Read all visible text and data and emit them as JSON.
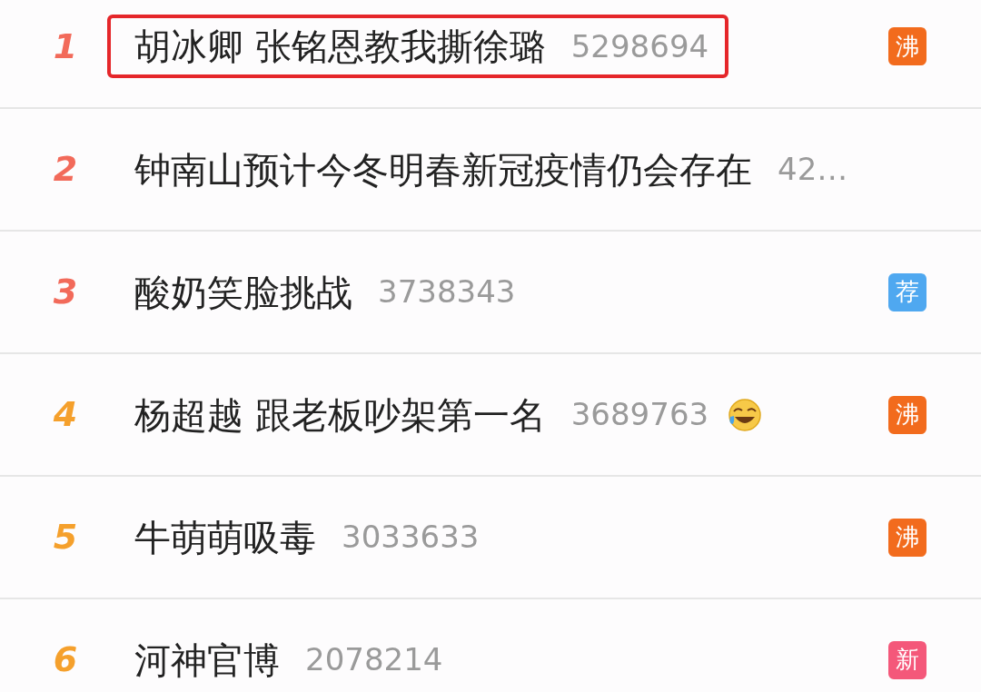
{
  "hot_list": [
    {
      "rank": "1",
      "color": "#f26a5a",
      "title": "胡冰卿 张铭恩教我撕徐璐",
      "count": "5298694",
      "highlighted": true,
      "emoji": false,
      "badge": {
        "kind": "boil",
        "text": "沸"
      }
    },
    {
      "rank": "2",
      "color": "#f26a5a",
      "title": "钟南山预计今冬明春新冠疫情仍会存在",
      "count": "42…",
      "highlighted": false,
      "emoji": false
    },
    {
      "rank": "3",
      "color": "#f26a5a",
      "title": "酸奶笑脸挑战",
      "count": "3738343",
      "highlighted": false,
      "emoji": false,
      "badge": {
        "kind": "recommend",
        "text": "荐"
      }
    },
    {
      "rank": "4",
      "color": "#f5a02c",
      "title": "杨超越 跟老板吵架第一名",
      "count": "3689763",
      "highlighted": false,
      "emoji": true,
      "badge": {
        "kind": "boil",
        "text": "沸"
      }
    },
    {
      "rank": "5",
      "color": "#f5a02c",
      "title": "牛萌萌吸毒",
      "count": "3033633",
      "highlighted": false,
      "emoji": false,
      "badge": {
        "kind": "boil",
        "text": "沸"
      }
    },
    {
      "rank": "6",
      "color": "#f5a02c",
      "title": "河神官博",
      "count": "2078214",
      "highlighted": false,
      "emoji": false,
      "badge": {
        "kind": "new",
        "text": "新"
      }
    }
  ]
}
